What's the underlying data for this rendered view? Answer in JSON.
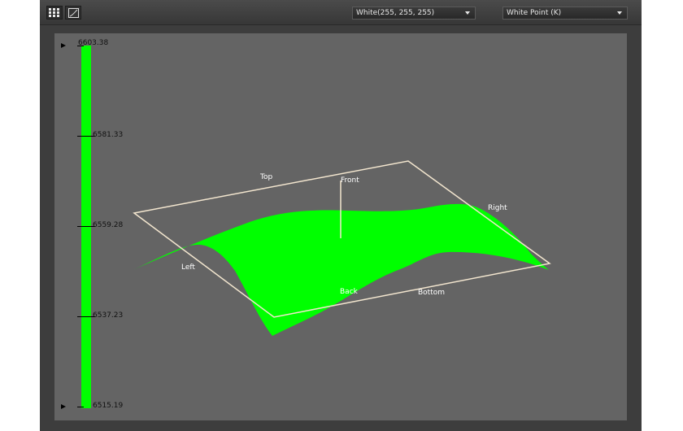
{
  "toolbar": {
    "tools": [
      {
        "name": "grid-view-icon",
        "active": true
      },
      {
        "name": "curve-view-icon",
        "active": false
      }
    ],
    "color_select": {
      "value": "White(255, 255, 255)"
    },
    "metric_select": {
      "value": "White Point (K)"
    }
  },
  "scale": {
    "colors": {
      "bar": "#00ff00"
    },
    "max_label": "6603.38",
    "ticks": [
      "6581.33",
      "6559.28",
      "6537.23"
    ],
    "min_label": "6515.19"
  },
  "plot": {
    "colors": {
      "surface": "#00ff00",
      "frame": "#f3e6cf",
      "labels": "#ffffff"
    },
    "labels": {
      "top": "Top",
      "front": "Front",
      "right": "Right",
      "left": "Left",
      "back": "Back",
      "bottom": "Bottom"
    }
  }
}
